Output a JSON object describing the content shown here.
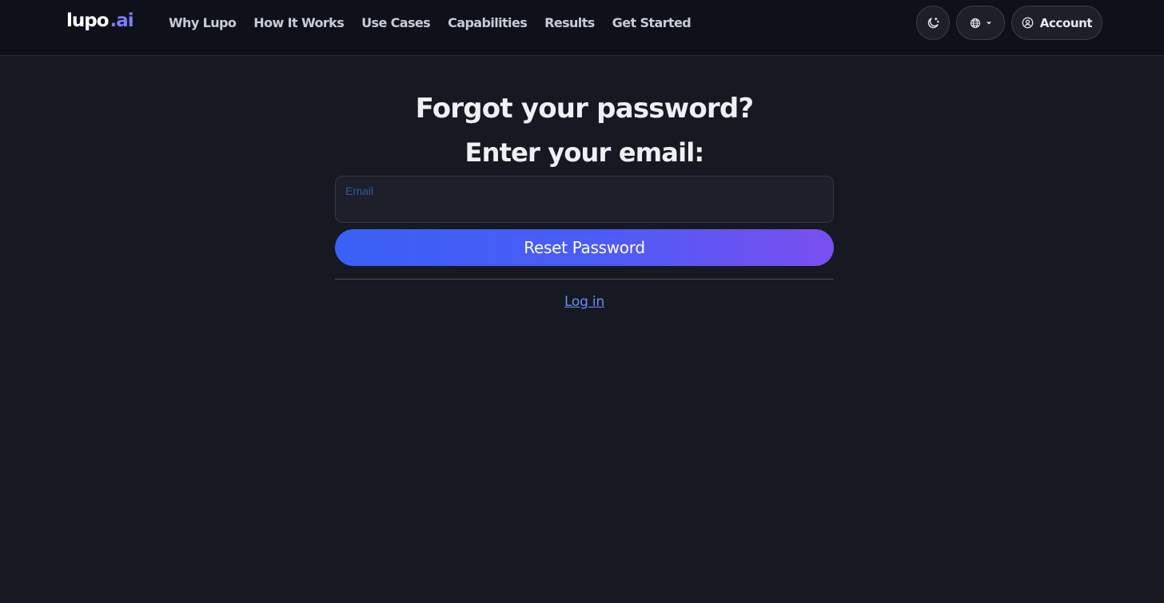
{
  "brand": {
    "name_main": "lupo",
    "name_suffix": ".ai",
    "accent": "#7b7ff5"
  },
  "nav": {
    "items": [
      {
        "label": "Why Lupo"
      },
      {
        "label": "How It Works"
      },
      {
        "label": "Use Cases"
      },
      {
        "label": "Capabilities"
      },
      {
        "label": "Results"
      },
      {
        "label": "Get Started"
      }
    ]
  },
  "header_actions": {
    "theme_icon": "moon-stars-icon",
    "language_icon": "globe-icon",
    "account_label": "Account",
    "account_icon": "user-circle-icon"
  },
  "form": {
    "title": "Forgot your password?",
    "subtitle": "Enter your email:",
    "email_label": "Email",
    "email_value": "",
    "submit_label": "Reset Password",
    "login_link": "Log in"
  },
  "colors": {
    "background": "#161922",
    "header_background": "#0e111a",
    "button_gradient_start": "#3a60f6",
    "button_gradient_end": "#7a4ff0",
    "link": "#6b8df5"
  }
}
